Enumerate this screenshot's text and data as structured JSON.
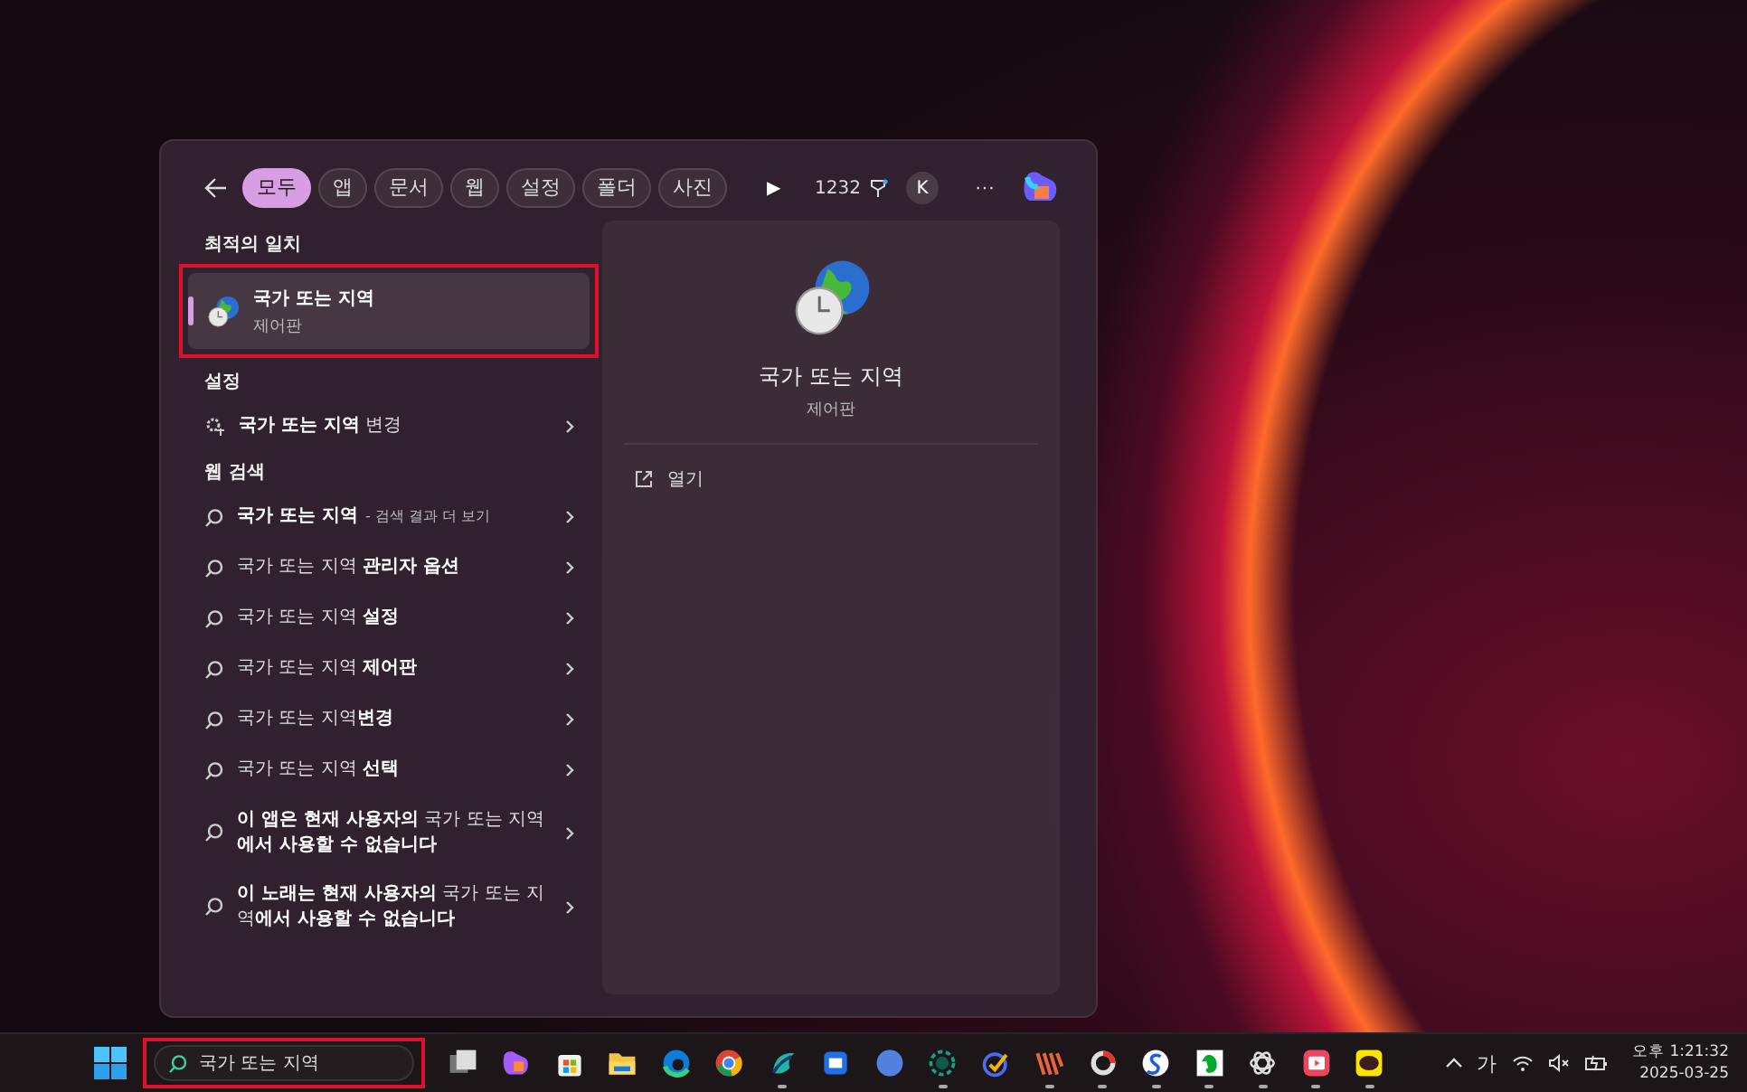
{
  "search_panel": {
    "filters": [
      {
        "label": "모두",
        "selected": true
      },
      {
        "label": "앱",
        "selected": false
      },
      {
        "label": "문서",
        "selected": false
      },
      {
        "label": "웹",
        "selected": false
      },
      {
        "label": "설정",
        "selected": false
      },
      {
        "label": "폴더",
        "selected": false
      },
      {
        "label": "사진",
        "selected": false
      }
    ],
    "more_filters": "▶",
    "points": "1232",
    "account": "K",
    "menu": "···",
    "best_match": {
      "heading": "최적의 일치",
      "title": "국가 또는 지역",
      "subtitle": "제어판",
      "selected": true
    },
    "settings": {
      "heading": "설정",
      "items": [
        {
          "text": "**국가 또는 지역** 변경"
        }
      ]
    },
    "web_search": {
      "heading": "웹 검색",
      "items": [
        {
          "text": "**국가 또는 지역**",
          "note": "- 검색 결과 더 보기"
        },
        {
          "text": "국가 또는 지역 **관리자 옵션**"
        },
        {
          "text": "국가 또는 지역 **설정**"
        },
        {
          "text": "국가 또는 지역 **제어판**"
        },
        {
          "text": "국가 또는 지역**변경**"
        },
        {
          "text": "국가 또는 지역 **선택**"
        },
        {
          "text": "**이 앱은 현재 사용자의** 국가 또는 지역**에서 사용할 수 없습니다**"
        },
        {
          "text": "**이 노래는 현재 사용자의** 국가 또는 지역**에서 사용할 수 없습니다**"
        }
      ]
    },
    "preview": {
      "title": "국가 또는 지역",
      "subtitle": "제어판",
      "actions": [
        {
          "label": "열기"
        }
      ]
    }
  },
  "taskbar": {
    "search_value": "국가 또는 지역",
    "apps": [
      {
        "running": false
      },
      {
        "running": false
      },
      {
        "running": false
      },
      {
        "running": false
      },
      {
        "running": false
      },
      {
        "running": false
      },
      {
        "running": true
      },
      {
        "running": false
      },
      {
        "running": false
      },
      {
        "running": true
      },
      {
        "running": false
      },
      {
        "running": true
      },
      {
        "running": true
      },
      {
        "running": true
      },
      {
        "running": true
      },
      {
        "running": true
      },
      {
        "running": true
      },
      {
        "running": true
      }
    ],
    "input_method": "가",
    "time": "오후 1:21:32",
    "date": "2025-03-25"
  }
}
